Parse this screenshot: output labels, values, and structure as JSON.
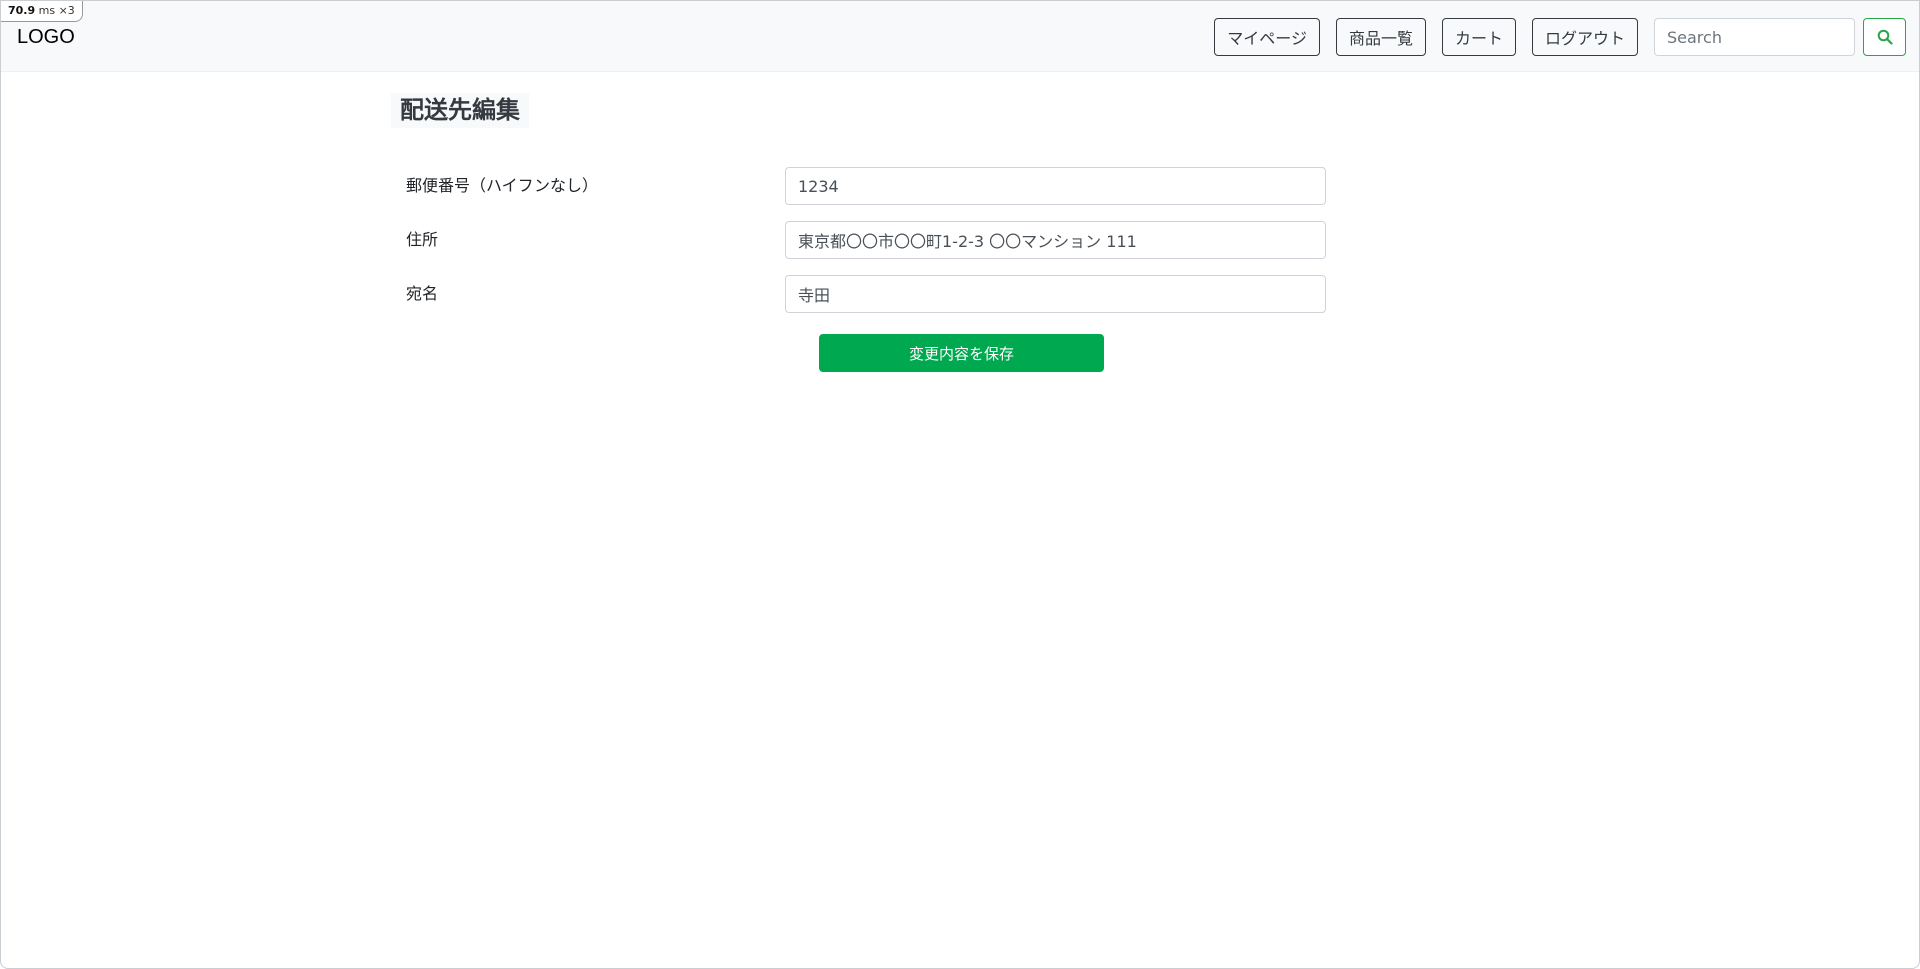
{
  "perf_badge": {
    "value": "70.9",
    "unit": "ms",
    "multiplier": "×3"
  },
  "navbar": {
    "logo": "LOGO",
    "buttons": [
      {
        "label": "マイページ"
      },
      {
        "label": "商品一覧"
      },
      {
        "label": "カート"
      },
      {
        "label": "ログアウト"
      }
    ],
    "search": {
      "placeholder": "Search",
      "value": "",
      "icon": "search-icon",
      "accent_color": "#28a745"
    }
  },
  "page": {
    "title": "配送先編集"
  },
  "form": {
    "fields": [
      {
        "label": "郵便番号（ハイフンなし）",
        "value": "1234"
      },
      {
        "label": "住所",
        "value": "東京都〇〇市〇〇町1-2-3 〇〇マンション 111"
      },
      {
        "label": "宛名",
        "value": "寺田"
      }
    ],
    "submit_label": "変更内容を保存",
    "submit_color": "#00a84f"
  }
}
